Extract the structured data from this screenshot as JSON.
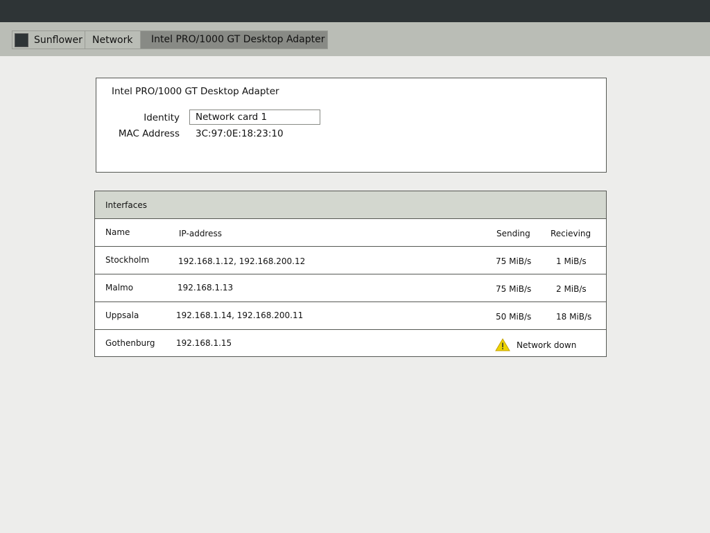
{
  "breadcrumb": {
    "home_icon": "home-icon",
    "items": [
      "Sunflower",
      "Network",
      "Intel PRO/1000 GT Desktop Adapter"
    ]
  },
  "adapter": {
    "title": "Intel PRO/1000 GT Desktop Adapter",
    "identity_label": "Identity",
    "identity_value": "Network card 1",
    "mac_label": "MAC Address",
    "mac_value": "3C:97:0E:18:23:10"
  },
  "interfaces": {
    "title": "Interfaces",
    "columns": {
      "name": "Name",
      "ip": "IP-address",
      "sending": "Sending",
      "receiving": "Recieving"
    },
    "rows": [
      {
        "name": "Stockholm",
        "ip": "192.168.1.12, 192.168.200.12",
        "sending": "75 MiB/s",
        "receiving": "1 MiB/s"
      },
      {
        "name": "Malmo",
        "ip": "192.168.1.13",
        "sending": "75 MiB/s",
        "receiving": "2 MiB/s"
      },
      {
        "name": "Uppsala",
        "ip": "192.168.1.14, 192.168.200.11",
        "sending": "50 MiB/s",
        "receiving": "18 MiB/s"
      },
      {
        "name": "Gothenburg",
        "ip": "192.168.1.15",
        "status": "Network down",
        "status_icon": "warning-icon"
      }
    ]
  },
  "colors": {
    "topbar": "#2e3436",
    "crumbbar": "#babdb6",
    "crumb_active": "#888a85",
    "table_header": "#d3d7cf",
    "warning": "#edd400"
  }
}
